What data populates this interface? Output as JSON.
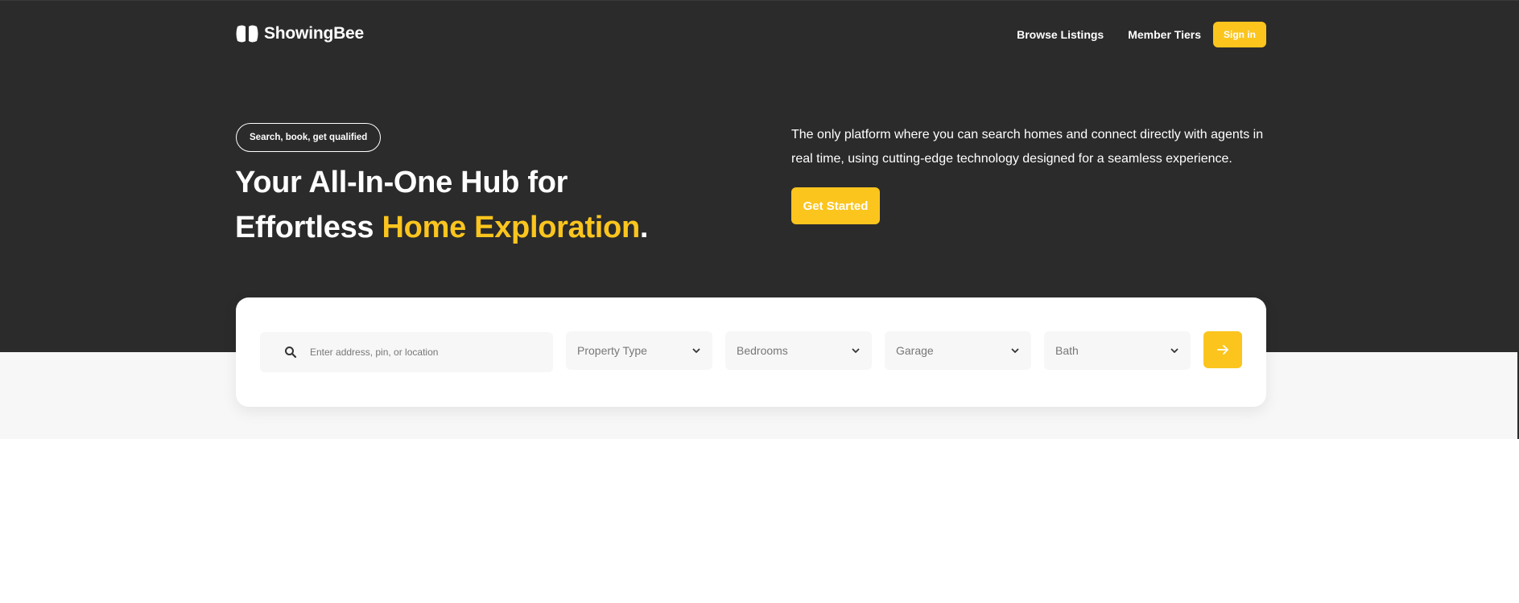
{
  "header": {
    "logo_text": "ShowingBee",
    "nav": [
      {
        "label": "Browse Listings"
      },
      {
        "label": "Member Tiers"
      }
    ],
    "signin_label": "Sign in"
  },
  "hero": {
    "pill": "Search, book, get qualified",
    "headline_line1": "Your All-In-One Hub for",
    "headline_line2_prefix": "Effortless ",
    "headline_accent": "Home Exploration",
    "headline_suffix": ".",
    "description": "The only platform where you can search homes and connect directly with agents in real time, using cutting-edge technology designed for a seamless experience.",
    "cta_label": "Get Started"
  },
  "search": {
    "placeholder": "Enter address, pin, or location",
    "filters": [
      {
        "label": "Property Type"
      },
      {
        "label": "Bedrooms"
      },
      {
        "label": "Garage"
      },
      {
        "label": "Bath"
      }
    ],
    "submit_icon": "arrow-right-icon"
  },
  "colors": {
    "accent": "#fbc51e",
    "hero_bg": "#2b2b2b",
    "band_bg": "#f7f7f7",
    "field_bg": "#f7f7f7"
  }
}
